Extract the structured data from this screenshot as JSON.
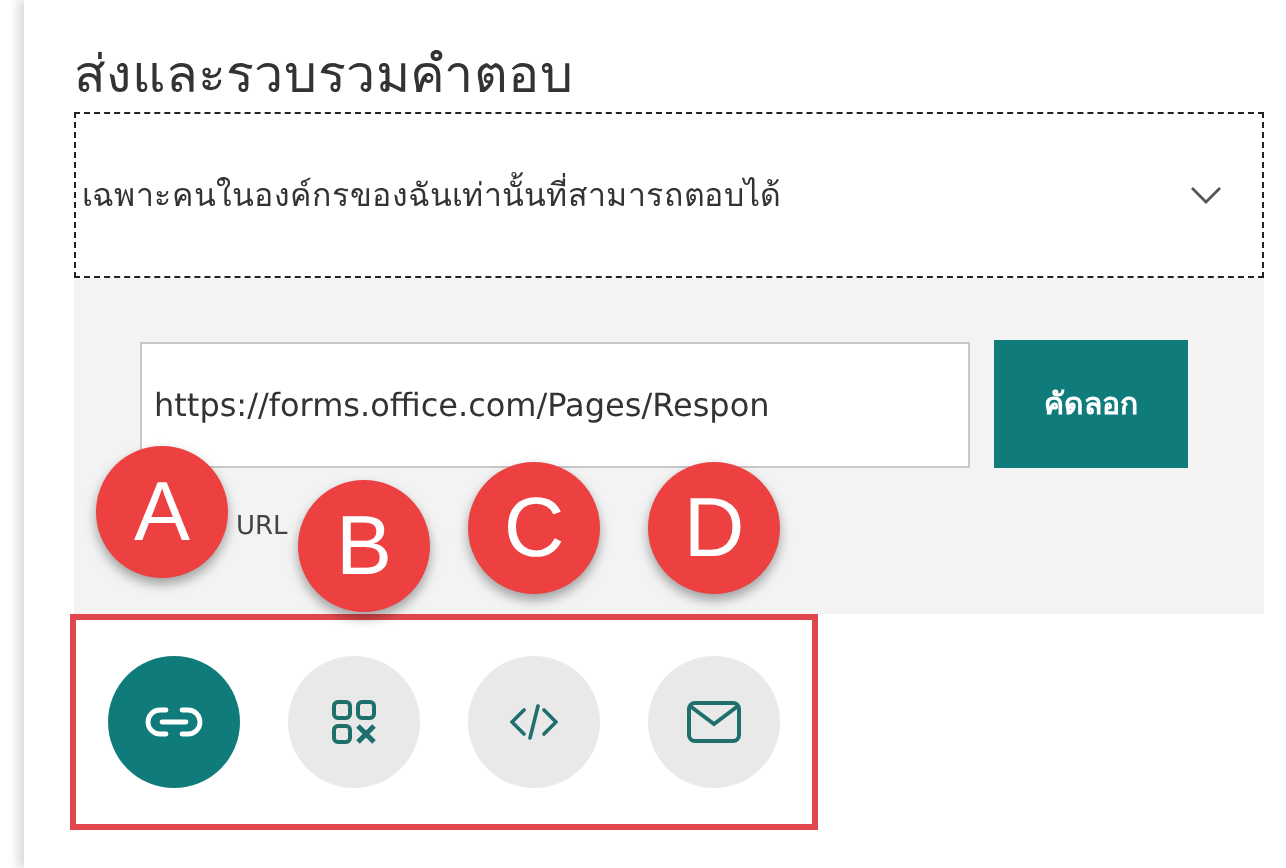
{
  "title": "ส่งและรวบรวมคำตอบ",
  "audience": {
    "value": "เฉพาะคนในองค์กรของฉันเท่านั้นที่สามารถตอบได้"
  },
  "link_field": {
    "value": "https://forms.office.com/Pages/Respon"
  },
  "copy_button": "คัดลอก",
  "url_note": "URL",
  "share_options": [
    {
      "kind": "link",
      "selected": true,
      "badge": "A"
    },
    {
      "kind": "qr",
      "selected": false,
      "badge": "B"
    },
    {
      "kind": "embed",
      "selected": false,
      "badge": "C"
    },
    {
      "kind": "email",
      "selected": false,
      "badge": "D"
    }
  ]
}
